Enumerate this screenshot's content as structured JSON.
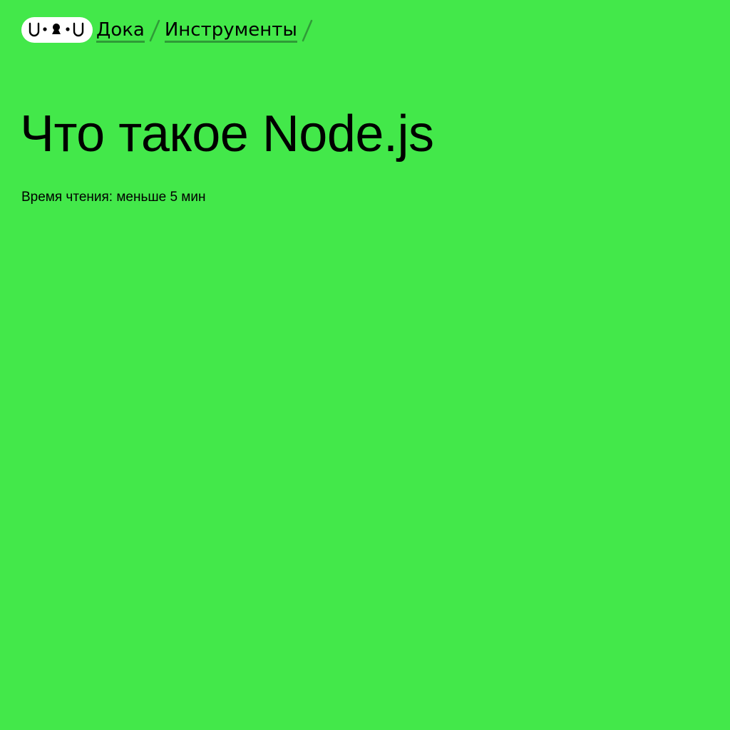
{
  "colors": {
    "background": "#43e84a",
    "accent_underline": "#2f9b37",
    "logo_background": "#ffffff",
    "text": "#000000"
  },
  "header": {
    "logo": {
      "icon": "doka-logo-icon",
      "text": "U•ᴥ•U"
    },
    "breadcrumbs": [
      {
        "label": "Дока"
      },
      {
        "label": "Инструменты"
      }
    ],
    "separator_icon": "slash-separator-icon"
  },
  "article": {
    "title": "Что такое Node.js",
    "reading_time": "Время чтения: меньше 5 мин"
  }
}
